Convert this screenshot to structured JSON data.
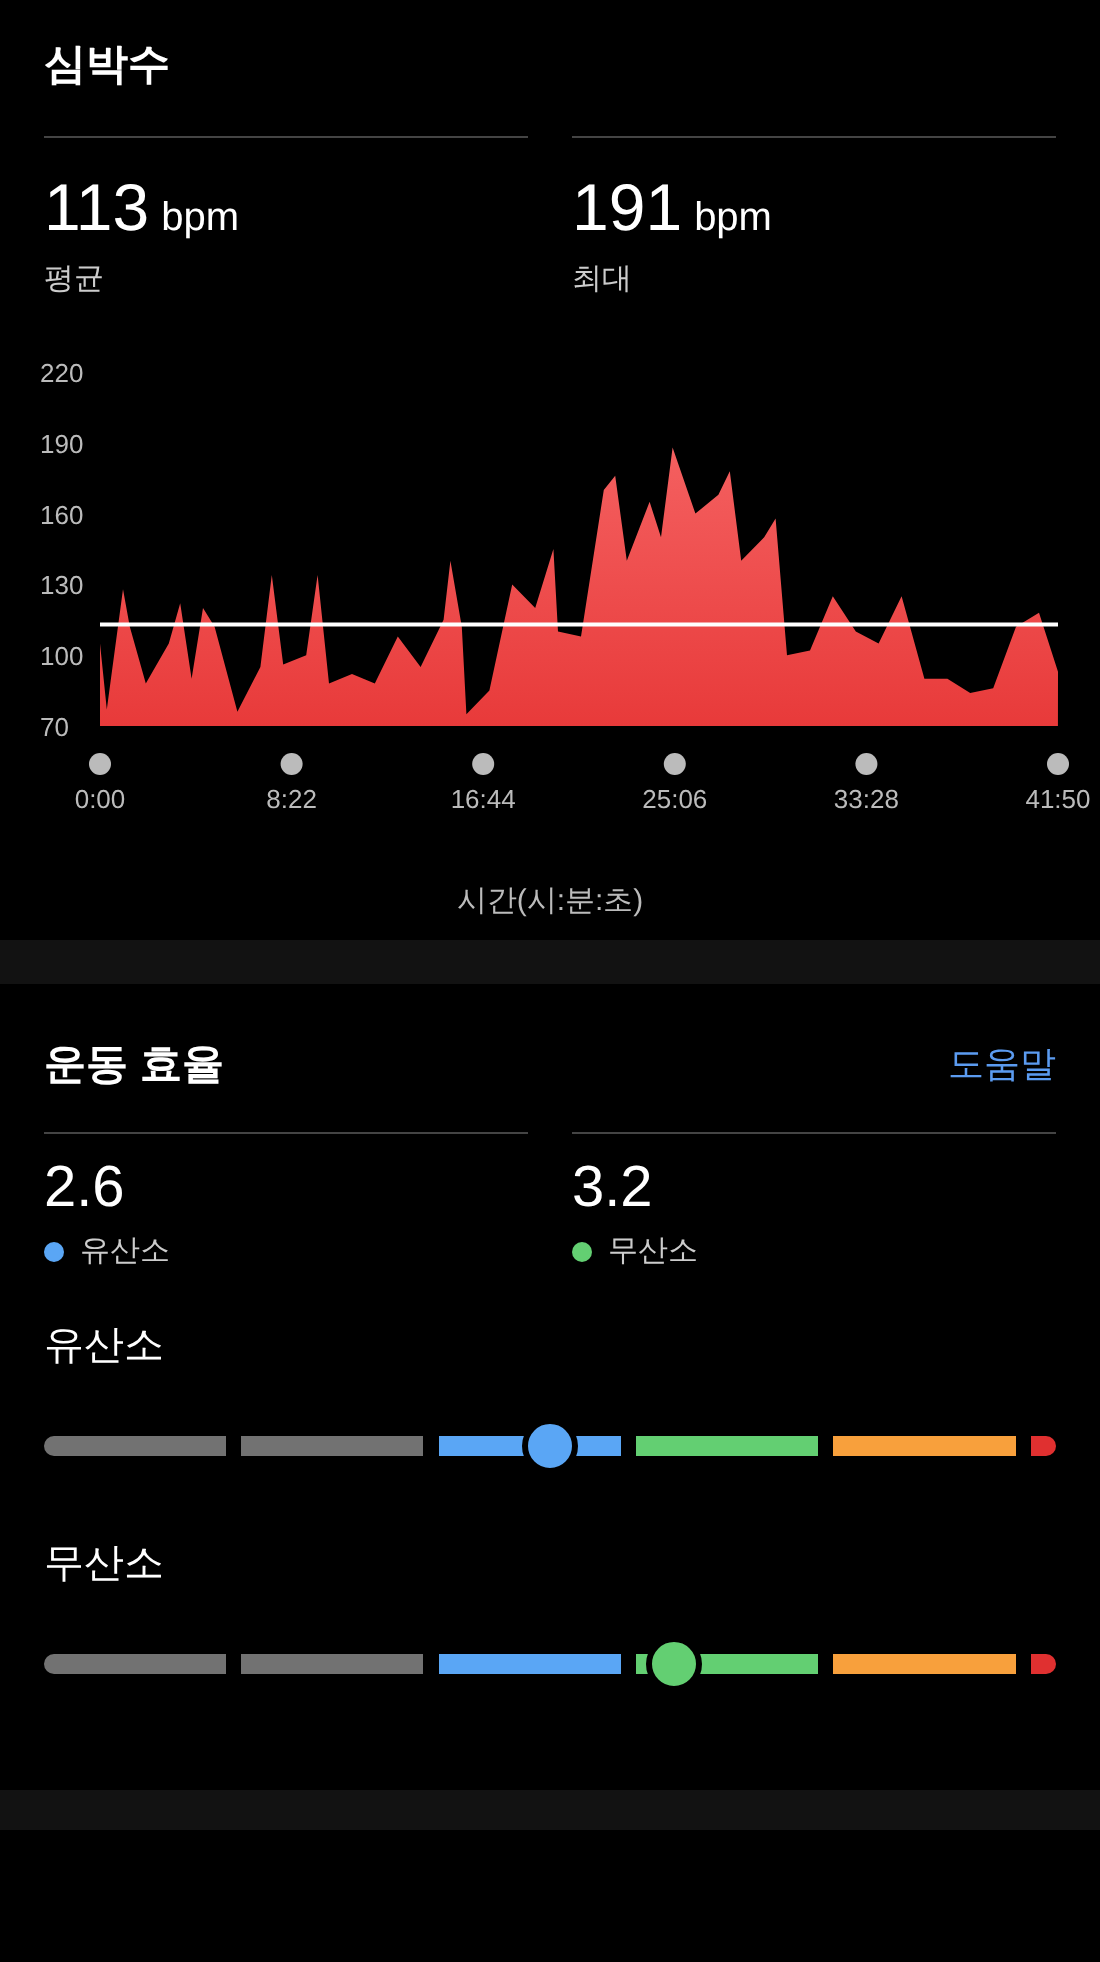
{
  "heart_rate": {
    "title": "심박수",
    "stats": [
      {
        "value": "113",
        "unit": "bpm",
        "label": "평균"
      },
      {
        "value": "191",
        "unit": "bpm",
        "label": "최대"
      }
    ],
    "chart_data": {
      "type": "area",
      "xlabel": "시간(시:분:초)",
      "x": [
        0,
        0.3,
        1,
        1.3,
        2,
        3,
        3.5,
        4,
        4.5,
        5,
        6,
        7,
        7.5,
        8,
        9,
        9.5,
        10,
        11,
        12,
        13,
        14,
        15,
        15.3,
        15.8,
        16,
        17,
        18,
        19,
        19.8,
        20,
        21,
        22,
        22.5,
        23,
        24,
        24.5,
        25,
        26,
        27,
        27.5,
        28,
        29,
        29.5,
        30,
        31,
        32,
        33,
        34,
        35,
        36,
        37,
        38,
        39,
        40,
        41,
        41.83
      ],
      "series": [
        {
          "color": "#e83a3a",
          "values": [
            105,
            77,
            128,
            112,
            88,
            105,
            122,
            90,
            120,
            112,
            76,
            95,
            134,
            96,
            100,
            134,
            88,
            92,
            88,
            108,
            95,
            115,
            140,
            112,
            75,
            85,
            130,
            120,
            145,
            110,
            108,
            170,
            176,
            140,
            165,
            150,
            188,
            160,
            168,
            178,
            140,
            150,
            158,
            100,
            102,
            125,
            110,
            105,
            125,
            90,
            90,
            84,
            86,
            112,
            118,
            93
          ]
        }
      ],
      "xlim": [
        0,
        41.833
      ],
      "ylim": [
        70,
        220
      ],
      "xticks": [
        {
          "value": 0,
          "label": "0:00"
        },
        {
          "value": 8.367,
          "label": "8:22"
        },
        {
          "value": 16.733,
          "label": "16:44"
        },
        {
          "value": 25.1,
          "label": "25:06"
        },
        {
          "value": 33.467,
          "label": "33:28"
        },
        {
          "value": 41.833,
          "label": "41:50"
        }
      ],
      "yticks": [
        70,
        100,
        130,
        160,
        190,
        220
      ],
      "ref_lines": [
        {
          "axis": "y",
          "value": 113
        }
      ]
    }
  },
  "efficiency": {
    "title": "운동 효율",
    "help_link": "도움말",
    "stats": [
      {
        "value": "2.6",
        "label": "유산소",
        "color": "#5aa6f5"
      },
      {
        "value": "3.2",
        "label": "무산소",
        "color": "#63cf72"
      }
    ],
    "gauges": [
      {
        "label": "유산소",
        "level": 0.5
      },
      {
        "label": "무산소",
        "level": 0.623
      }
    ]
  }
}
